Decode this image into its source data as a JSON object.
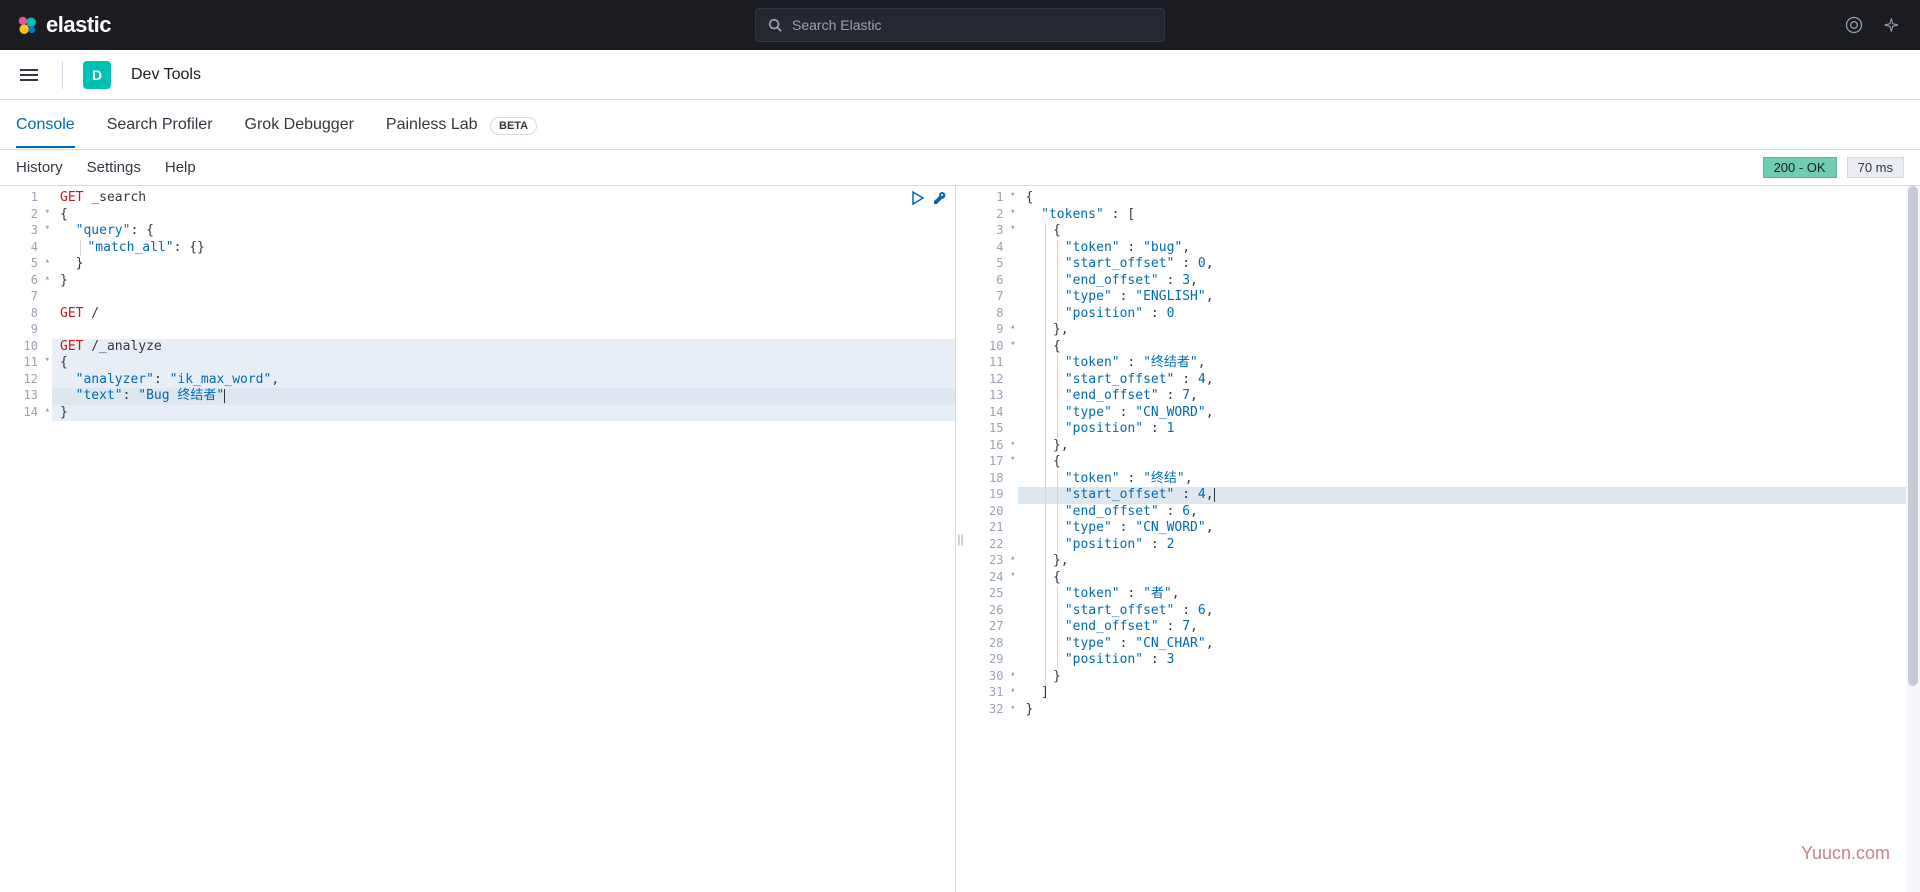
{
  "header": {
    "brand": "elastic",
    "search_placeholder": "Search Elastic"
  },
  "nav": {
    "badge": "D",
    "title": "Dev Tools"
  },
  "tabs": [
    {
      "label": "Console",
      "active": true
    },
    {
      "label": "Search Profiler",
      "active": false
    },
    {
      "label": "Grok Debugger",
      "active": false
    },
    {
      "label": "Painless Lab",
      "active": false,
      "badge": "BETA"
    }
  ],
  "toolbar": {
    "history": "History",
    "settings": "Settings",
    "help": "Help",
    "status": "200 - OK",
    "time": "70 ms"
  },
  "request_editor": {
    "lines": [
      {
        "num": "1"
      },
      {
        "num": "2",
        "fold": "▾"
      },
      {
        "num": "3",
        "fold": "▾"
      },
      {
        "num": "4"
      },
      {
        "num": "5",
        "fold": "▴"
      },
      {
        "num": "6",
        "fold": "▴"
      },
      {
        "num": "7"
      },
      {
        "num": "8"
      },
      {
        "num": "9"
      },
      {
        "num": "10",
        "hl": true
      },
      {
        "num": "11",
        "fold": "▾",
        "hl": true
      },
      {
        "num": "12",
        "hl": true
      },
      {
        "num": "13",
        "hl": true,
        "cursor": true
      },
      {
        "num": "14",
        "fold": "▴",
        "hl": true
      }
    ],
    "code": {
      "line1_method": "GET",
      "line1_path": " _search",
      "line3_key": "\"query\"",
      "line4_key": "\"match_all\"",
      "line8_method": "GET",
      "line8_path": " /",
      "line10_method": "GET",
      "line10_path": " /_analyze",
      "line12_key": "\"analyzer\"",
      "line12_val": "\"ik_max_word\"",
      "line13_key": "\"text\"",
      "line13_val": "\"Bug 终结者\""
    }
  },
  "response_editor": {
    "lines": [
      {
        "num": "1",
        "fold": "▾"
      },
      {
        "num": "2",
        "fold": "▾"
      },
      {
        "num": "3",
        "fold": "▾"
      },
      {
        "num": "4"
      },
      {
        "num": "5"
      },
      {
        "num": "6"
      },
      {
        "num": "7"
      },
      {
        "num": "8"
      },
      {
        "num": "9",
        "fold": "▴"
      },
      {
        "num": "10",
        "fold": "▾"
      },
      {
        "num": "11"
      },
      {
        "num": "12"
      },
      {
        "num": "13"
      },
      {
        "num": "14"
      },
      {
        "num": "15"
      },
      {
        "num": "16",
        "fold": "▴"
      },
      {
        "num": "17",
        "fold": "▾"
      },
      {
        "num": "18"
      },
      {
        "num": "19",
        "cursor": true
      },
      {
        "num": "20"
      },
      {
        "num": "21"
      },
      {
        "num": "22"
      },
      {
        "num": "23",
        "fold": "▴"
      },
      {
        "num": "24",
        "fold": "▾"
      },
      {
        "num": "25"
      },
      {
        "num": "26"
      },
      {
        "num": "27"
      },
      {
        "num": "28"
      },
      {
        "num": "29"
      },
      {
        "num": "30",
        "fold": "▴"
      },
      {
        "num": "31",
        "fold": "▴"
      },
      {
        "num": "32",
        "fold": "▴"
      }
    ],
    "data": {
      "tokens_key": "\"tokens\"",
      "token_key": "\"token\"",
      "start_offset_key": "\"start_offset\"",
      "end_offset_key": "\"end_offset\"",
      "type_key": "\"type\"",
      "position_key": "\"position\"",
      "tokens": [
        {
          "token": "\"bug\"",
          "start_offset": "0",
          "end_offset": "3",
          "type": "\"ENGLISH\"",
          "position": "0"
        },
        {
          "token": "\"终结者\"",
          "start_offset": "4",
          "end_offset": "7",
          "type": "\"CN_WORD\"",
          "position": "1"
        },
        {
          "token": "\"终结\"",
          "start_offset": "4",
          "end_offset": "6",
          "type": "\"CN_WORD\"",
          "position": "2"
        },
        {
          "token": "\"者\"",
          "start_offset": "6",
          "end_offset": "7",
          "type": "\"CN_CHAR\"",
          "position": "3"
        }
      ]
    }
  },
  "watermark": "Yuucn.com"
}
